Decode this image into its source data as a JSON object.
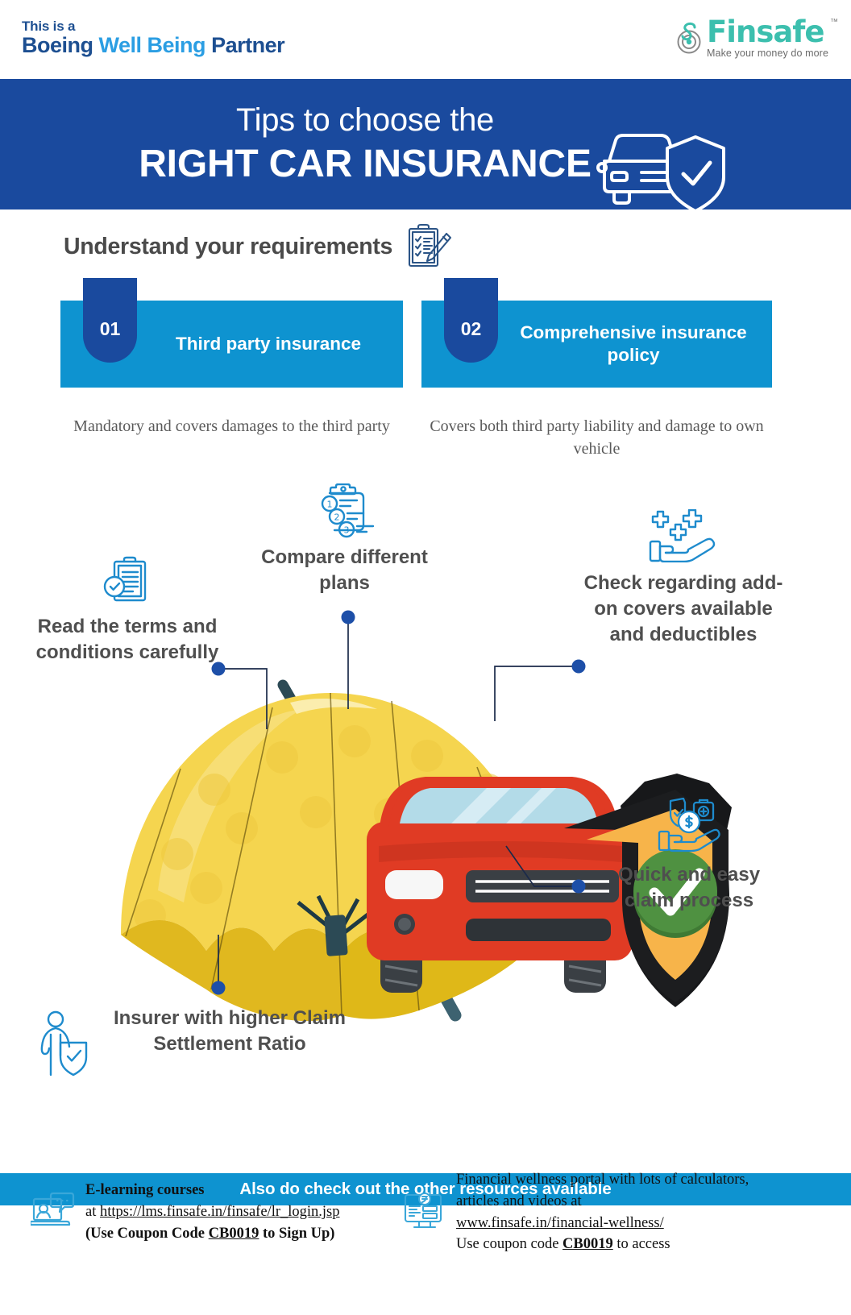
{
  "header": {
    "partner_line1": "This is a",
    "partner_word1": "Boeing",
    "partner_word2": "Well Being",
    "partner_word3": "Partner",
    "brand_name": "Finsafe",
    "brand_tm": "™",
    "brand_tagline": "Make your money do more"
  },
  "title": {
    "small": "Tips to choose the",
    "big": "RIGHT CAR INSURANCE",
    "icon": "car-shield-icon"
  },
  "requirements": {
    "heading": "Understand your requirements",
    "icon": "clipboard-pencil-icon",
    "cards": [
      {
        "number": "01",
        "label": "Third party insurance",
        "description": "Mandatory and covers damages to the third party"
      },
      {
        "number": "02",
        "label": "Comprehensive insurance policy",
        "description": "Covers both third party liability and damage to own vehicle"
      }
    ]
  },
  "tips": [
    {
      "id": "read-terms",
      "text": "Read the terms and conditions carefully",
      "icon": "clipboard-check-icon"
    },
    {
      "id": "compare-plans",
      "text": "Compare different plans",
      "icon": "numbered-list-clipboard-icon"
    },
    {
      "id": "add-on-covers",
      "text": "Check regarding add-on covers available and deductibles",
      "icon": "hand-plus-benefits-icon"
    },
    {
      "id": "claim-process",
      "text": "Quick and easy claim process",
      "icon": "hand-money-shield-icon"
    },
    {
      "id": "claim-settlement-ratio",
      "text": "Insurer with higher Claim Settlement Ratio",
      "icon": "person-shield-icon"
    }
  ],
  "illustration": {
    "umbrella": "yellow-umbrella",
    "car": "red-car-front",
    "shield": "orange-shield-check"
  },
  "cta": {
    "text": "Also do check out the other resources available"
  },
  "footer": {
    "left": {
      "icon": "elearning-laptop-icon",
      "title": "E-learning  courses",
      "line2_prefix": "at ",
      "link": "https://lms.finsafe.in/finsafe/lr_login.jsp",
      "line3_pre": "(Use Coupon  Code ",
      "coupon": "CB0019",
      "line3_post": " to Sign Up)"
    },
    "right": {
      "icon": "financial-portal-monitor-icon",
      "line1": "Financial wellness portal with lots of calculators,",
      "line2": "articles and videos at",
      "link": "www.finsafe.in/financial-wellness/",
      "line4_pre": "Use coupon code ",
      "coupon": "CB0019",
      "line4_post": " to access"
    }
  },
  "colors": {
    "brand_blue_dark": "#1a4a9e",
    "brand_blue_light": "#0e93d0",
    "brand_teal": "#3cbfae",
    "icon_blue": "#1e8bcd",
    "text_gray": "#4f4f4f",
    "umbrella_yellow": "#f5d54f",
    "car_red": "#e03b24",
    "shield_orange": "#f7b44a",
    "check_green": "#4a8c3f"
  }
}
